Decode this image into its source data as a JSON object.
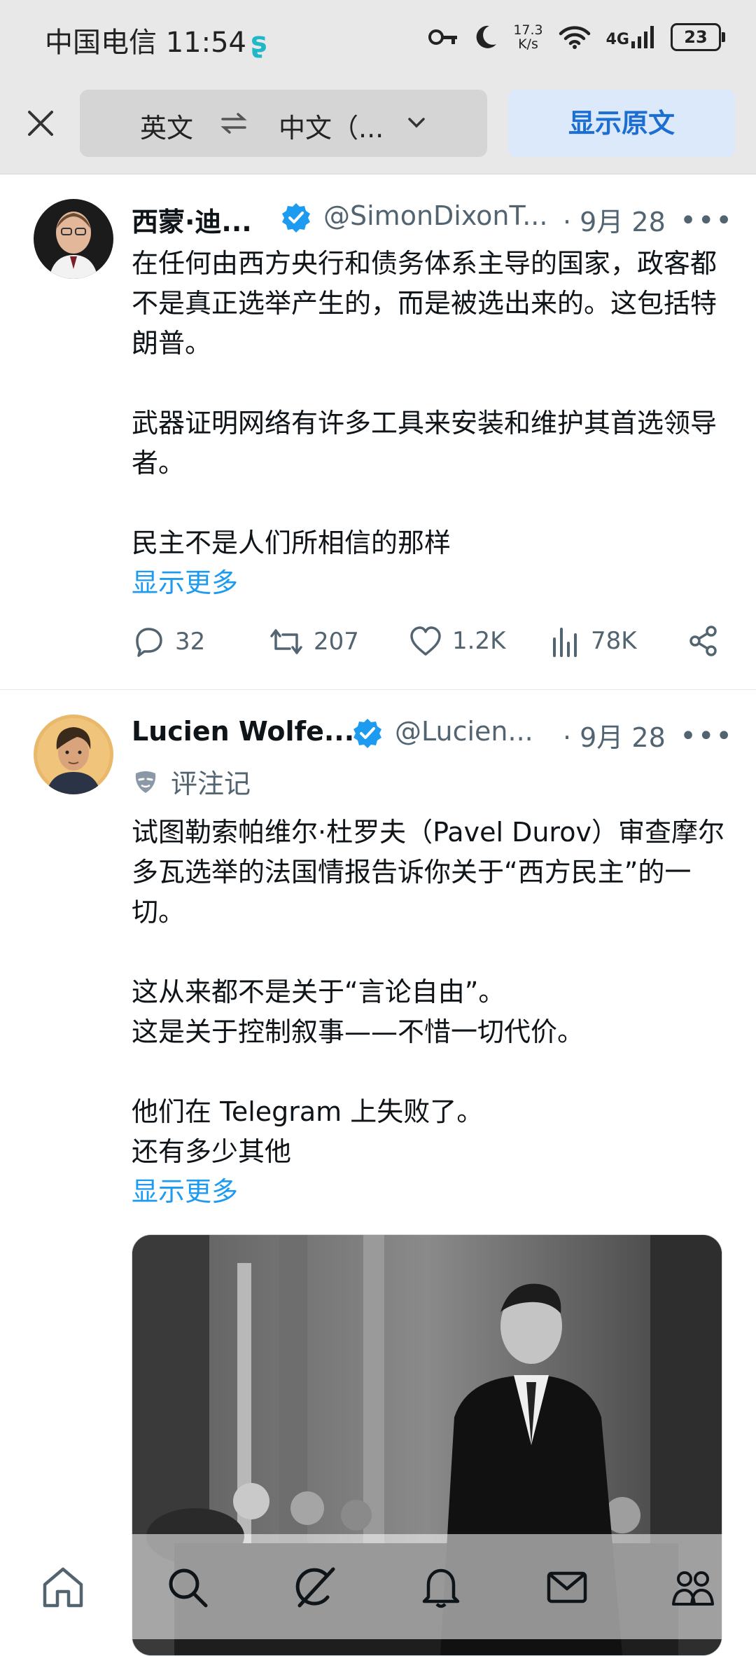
{
  "status_bar": {
    "carrier_time": "中国电信 11:54",
    "speed_top": "17.3",
    "speed_bottom": "K/s",
    "network": "4G",
    "battery": "23"
  },
  "translate_bar": {
    "from_lang": "英文",
    "to_lang": "中文（...",
    "show_original": "显示原文"
  },
  "tweets": [
    {
      "name": "西蒙·迪...",
      "handle": "@SimonDixonT...",
      "date": "· 9月 28",
      "paragraphs": [
        "在任何由西方央行和债务体系主导的国家，政客都不是真正选举产生的，而是被选出来的。这包括特朗普。",
        "武器证明网络有许多工具来安装和维护其首选领导者。",
        "民主不是人们所相信的那样"
      ],
      "show_more": "显示更多",
      "replies": "32",
      "reposts": "207",
      "likes": "1.2K",
      "views": "78K"
    },
    {
      "name": "Lucien Wolfe...",
      "handle": "@Lucien...",
      "date": "· 9月 28",
      "note": "评注记",
      "paragraphs": [
        "试图勒索帕维尔·杜罗夫（Pavel Durov）审查摩尔多瓦选举的法国情报告诉你关于“西方民主”的一切。",
        "这从来都不是关于“言论自由”。",
        "这是关于控制叙事——不惜一切代价。",
        "他们在 Telegram 上失败了。",
        "还有多少其他"
      ],
      "show_more": "显示更多"
    }
  ],
  "colors": {
    "accent": "#1d9bf0",
    "verified": "#1d9bf0",
    "secondary_text": "#536471",
    "translate_button_bg": "#dce9fb"
  },
  "icons": [
    "close-icon",
    "swap-icon",
    "chevron-down-icon",
    "key-icon",
    "moon-icon",
    "wifi-icon",
    "signal-icon",
    "verified-icon",
    "more-icon",
    "reply-icon",
    "repost-icon",
    "like-icon",
    "views-icon",
    "share-icon",
    "mask-icon",
    "home-icon",
    "search-icon",
    "grok-icon",
    "notifications-icon",
    "messages-icon",
    "communities-icon"
  ]
}
